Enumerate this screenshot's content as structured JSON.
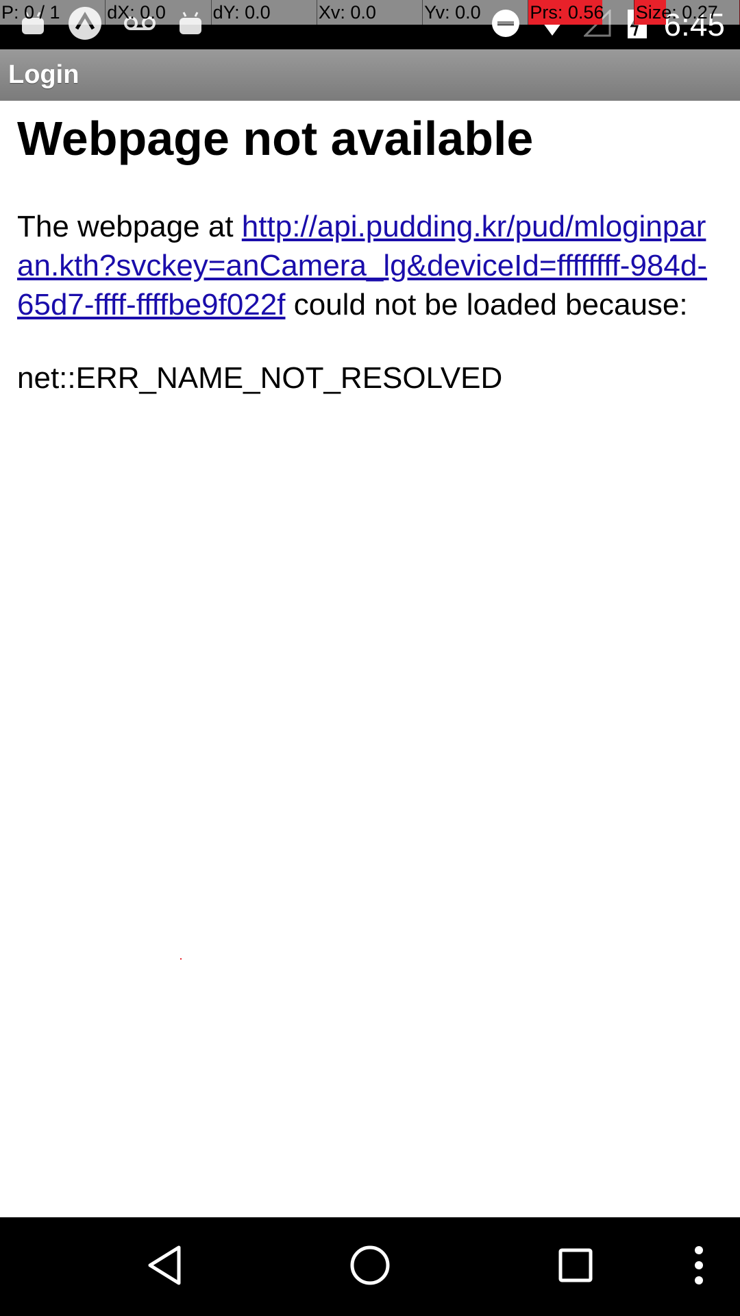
{
  "status_bar": {
    "time": "6:45",
    "left_icons": [
      "android-icon",
      "sync-icon",
      "voicemail-icon",
      "android-icon"
    ],
    "right_icons": [
      "do-not-disturb-icon",
      "wifi-icon",
      "signal-icon",
      "battery-icon"
    ]
  },
  "pointer_overlay": {
    "p": "P: 0 / 1",
    "dx": "dX: 0.0",
    "dy": "dY: 0.0",
    "xv": "Xv: 0.0",
    "yv": "Yv: 0.0",
    "prs": "Prs: 0.56",
    "size": "Size: 0.27"
  },
  "action_bar": {
    "title": "Login"
  },
  "error_page": {
    "title": "Webpage not available",
    "body_prefix": "The webpage at ",
    "url": "http://api.pudding.kr/pud/mloginparan.kth?svckey=anCamera_lg&deviceId=ffffffff-984d-65d7-ffff-ffffbe9f022f",
    "body_suffix": " could not be loaded because:",
    "error_code": "net::ERR_NAME_NOT_RESOLVED"
  },
  "nav_bar": {
    "buttons": [
      "back-icon",
      "home-icon",
      "recents-icon",
      "overflow-menu-icon"
    ]
  },
  "colors": {
    "status_bar_bg": "#000000",
    "action_bar_bg": "#8a8a8a",
    "link": "#1a0dab",
    "overlay_alert": "#e8212a"
  }
}
